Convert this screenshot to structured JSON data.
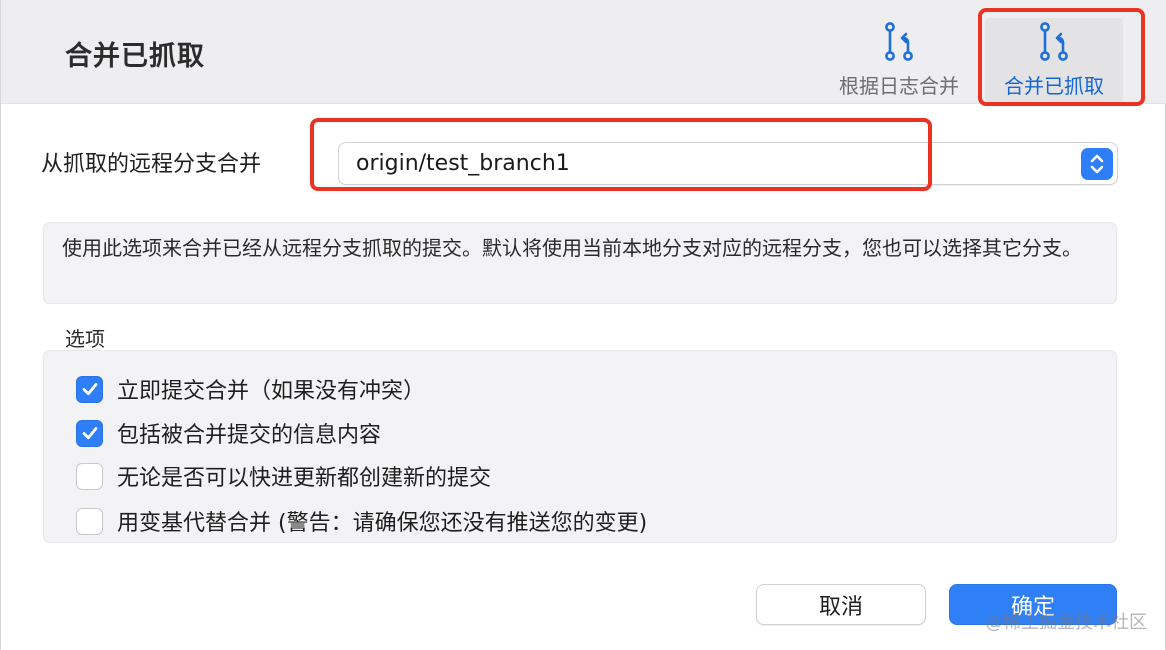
{
  "dialog": {
    "title": "合并已抓取"
  },
  "toolbar": {
    "merge_from_log_label": "根据日志合并",
    "merge_fetched_label": "合并已抓取"
  },
  "remote_branch": {
    "label": "从抓取的远程分支合并",
    "selected_value": "origin/test_branch1"
  },
  "info_text": "使用此选项来合并已经从远程分支抓取的提交。默认将使用当前本地分支对应的远程分支，您也可以选择其它分支。",
  "options": {
    "title": "选项",
    "items": [
      {
        "label": "立即提交合并（如果没有冲突）",
        "checked": true
      },
      {
        "label": "包括被合并提交的信息内容",
        "checked": true
      },
      {
        "label": "无论是否可以快进更新都创建新的提交",
        "checked": false
      },
      {
        "label": "用变基代替合并 (警告：请确保您还没有推送您的变更)",
        "checked": false
      }
    ]
  },
  "buttons": {
    "cancel": "取消",
    "ok": "确定"
  },
  "watermark": "@稀土掘金技术社区",
  "colors": {
    "accent": "#2d7ef7",
    "highlight_box": "#ea3323",
    "selected_toolbar_label": "#1565d8"
  }
}
